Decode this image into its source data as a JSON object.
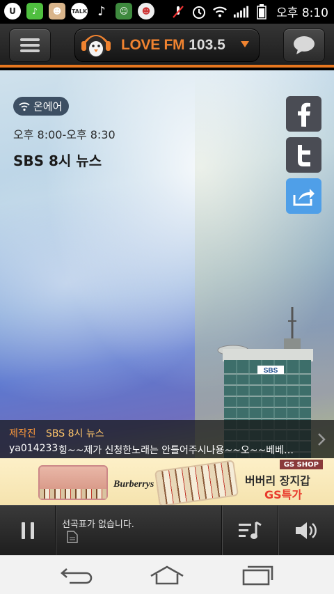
{
  "status_bar": {
    "clock": "오후 8:10",
    "notification_icons": [
      "u-plus-icon",
      "music-app-icon",
      "lovefm-app-icon",
      "kakaotalk-icon",
      "music-note-icon",
      "frog-app-icon",
      "bunny-app-icon"
    ],
    "talk_label": "TALK",
    "system_icons": [
      "mute-icon",
      "alarm-icon",
      "wifi-icon",
      "signal-icon",
      "battery-icon"
    ]
  },
  "header": {
    "station_name": "LOVE FM",
    "station_frequency": "103.5",
    "accent_color": "#f08330"
  },
  "hero": {
    "onair_label": "온에어",
    "time_range": "오후 8:00-오후 8:30",
    "show_title": "SBS 8시 뉴스"
  },
  "social": [
    "facebook-icon",
    "twitter-icon",
    "share-icon"
  ],
  "ticker": {
    "credit_label": "제작진",
    "credit_value": "SBS 8시 뉴스",
    "message_user": "ya014233",
    "message_text": "힝~~제가 신청한노래는 안틀어주시나용~~오~~베베~~"
  },
  "ad": {
    "badge": "GS SHOP",
    "brand": "Burberrys",
    "title": "버버리 장지갑",
    "subtitle": "GS특가"
  },
  "player": {
    "now_playing": "선곡표가 없습니다."
  }
}
